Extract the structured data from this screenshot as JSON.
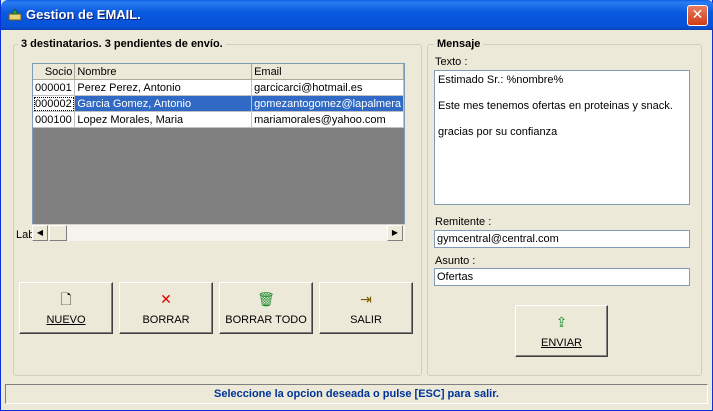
{
  "window": {
    "title": "Gestion de EMAIL.",
    "close_glyph": "✕"
  },
  "left_group": {
    "legend": "3 destinatarios.  3 pendientes de envío.",
    "side_label": "Lab"
  },
  "grid": {
    "columns": [
      "Socio",
      "Nombre",
      "Email"
    ],
    "rows": [
      {
        "socio": "000001",
        "nombre": "Perez Perez, Antonio",
        "email": "garcicarci@hotmail.es"
      },
      {
        "socio": "000002",
        "nombre": "Garcia Gomez, Antonio",
        "email": "gomezantogomez@lapalmera"
      },
      {
        "socio": "000100",
        "nombre": "Lopez Morales, Maria",
        "email": "mariamorales@yahoo.com"
      }
    ],
    "selected_row_index": 1
  },
  "buttons": {
    "nuevo": {
      "label": "NUEVO",
      "icon": "new-document-icon",
      "glyph": "🗋"
    },
    "borrar": {
      "label": "BORRAR",
      "icon": "red-x-icon",
      "glyph": "✕"
    },
    "borrar_todo": {
      "label": "BORRAR TODO",
      "icon": "trash-bin-icon",
      "glyph": "🗑"
    },
    "salir": {
      "label": "SALIR",
      "icon": "exit-door-icon",
      "glyph": "⇥"
    },
    "enviar": {
      "label": "ENVIAR",
      "icon": "outbox-tray-icon",
      "glyph": "⇪"
    }
  },
  "mensaje": {
    "legend": "Mensaje",
    "texto_label": "Texto :",
    "texto_value": "Estimado Sr.: %nombre%\n\nEste mes tenemos ofertas en proteinas y snack.\n\ngracias por su confianza",
    "remitente_label": "Remitente :",
    "remitente_value": "gymcentral@central.com",
    "asunto_label": "Asunto :",
    "asunto_value": "Ofertas"
  },
  "status": {
    "text": "Seleccione la opcion deseada o pulse [ESC] para salir."
  },
  "colors": {
    "titlebar": "#0a5ae0",
    "selection": "#316ac5",
    "status_text": "#003399",
    "face": "#ece9d8",
    "delete_red": "#e00000",
    "trash_green": "#1c8a2e"
  }
}
